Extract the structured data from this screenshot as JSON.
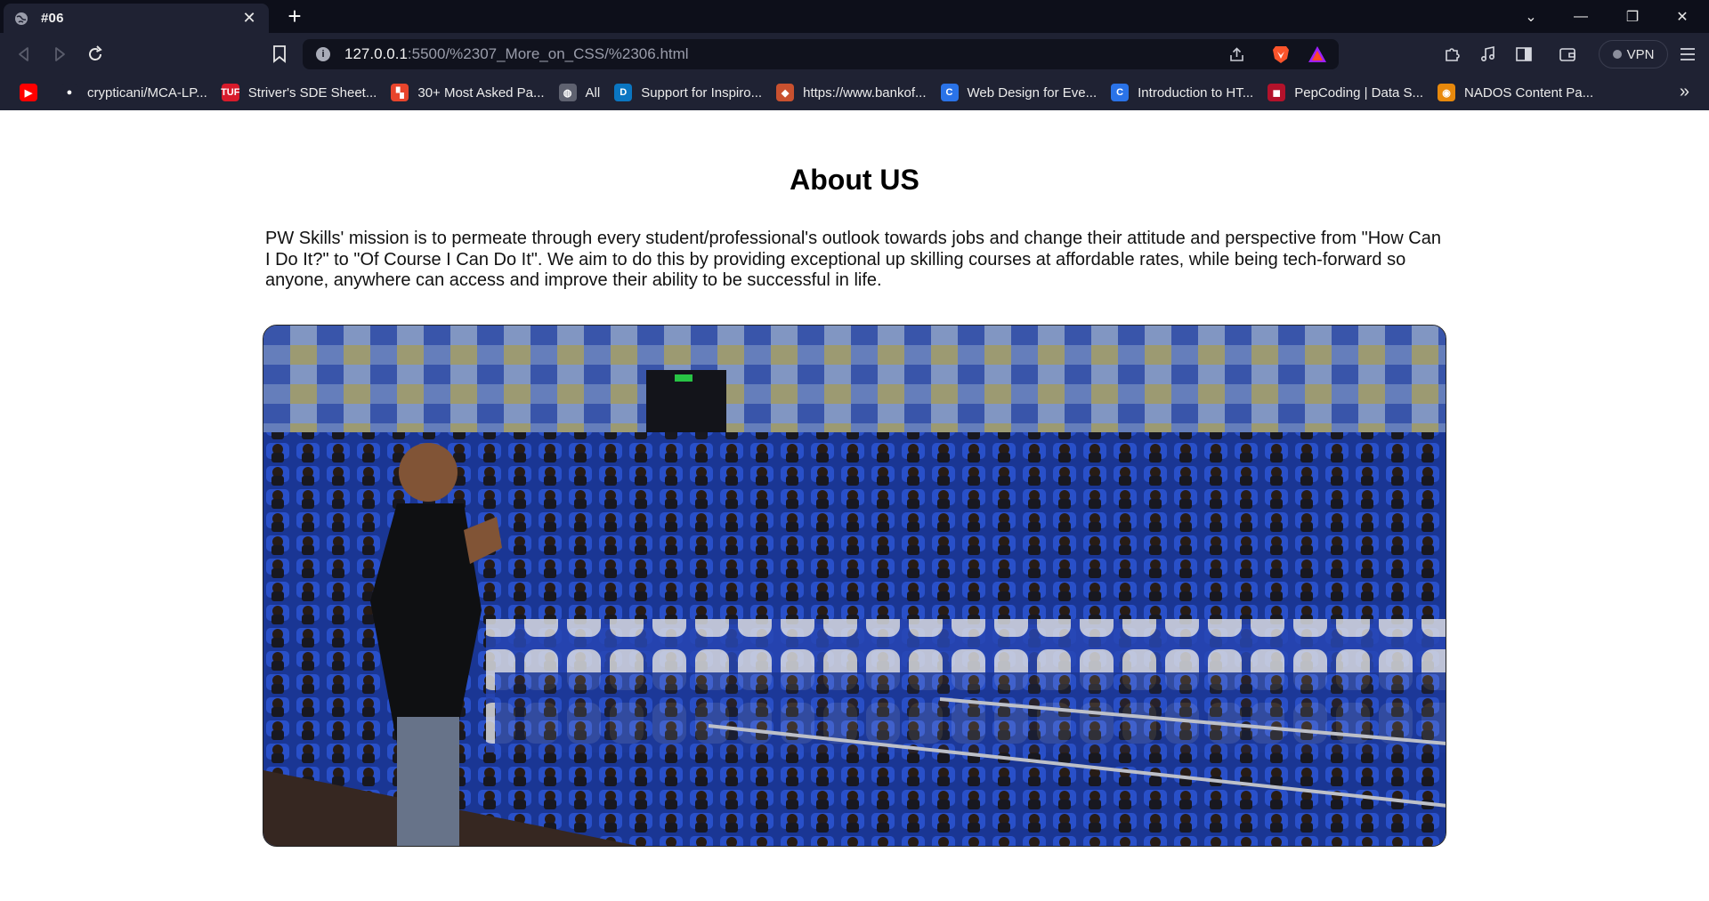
{
  "browser": {
    "tab": {
      "title": "#06",
      "close_glyph": "✕"
    },
    "new_tab_glyph": "+",
    "window_controls": {
      "tab_search": "⌄",
      "minimize": "—",
      "restore": "❐",
      "close": "✕"
    },
    "url": {
      "host": "127.0.0.1",
      "path": ":5500/%2307_More_on_CSS/%2306.html"
    },
    "vpn_label": "VPN",
    "bookmarks": [
      {
        "label": "",
        "icon": "youtube-icon",
        "color": "#ff0000",
        "glyph": "▶"
      },
      {
        "label": "crypticani/MCA-LP...",
        "icon": "github-icon",
        "color": "#1f2233",
        "glyph": "●"
      },
      {
        "label": "Striver's SDE Sheet...",
        "icon": "tuf-icon",
        "color": "#d81b2b",
        "glyph": "TUF"
      },
      {
        "label": "30+ Most Asked Pa...",
        "icon": "pattern-icon",
        "color": "#e8452c",
        "glyph": "▚"
      },
      {
        "label": "All",
        "icon": "globe-icon",
        "color": "#5f6270",
        "glyph": "◍"
      },
      {
        "label": "Support for Inspiro...",
        "icon": "dell-icon",
        "color": "#0a76c2",
        "glyph": "D"
      },
      {
        "label": "https://www.bankof...",
        "icon": "bank-icon",
        "color": "#c9512f",
        "glyph": "◆"
      },
      {
        "label": "Web Design for Eve...",
        "icon": "coursera-icon",
        "color": "#2a73e8",
        "glyph": "C"
      },
      {
        "label": "Introduction to HT...",
        "icon": "coursera-icon",
        "color": "#2a73e8",
        "glyph": "C"
      },
      {
        "label": "PepCoding | Data S...",
        "icon": "pepcoding-icon",
        "color": "#b3122b",
        "glyph": "◼"
      },
      {
        "label": "NADOS Content Pa...",
        "icon": "nados-icon",
        "color": "#e8890c",
        "glyph": "◉"
      }
    ],
    "bookmarks_more": "»"
  },
  "page": {
    "heading": "About US",
    "paragraph": "PW Skills' mission is to permeate through every student/professional's outlook towards jobs and change their attitude and perspective from \"How Can I Do It?\" to \"Of Course I Can Do It\". We aim to do this by providing exceptional up skilling courses at affordable rates, while being tech-forward so anyone, anywhere can access and improve their ability to be successful in life."
  }
}
